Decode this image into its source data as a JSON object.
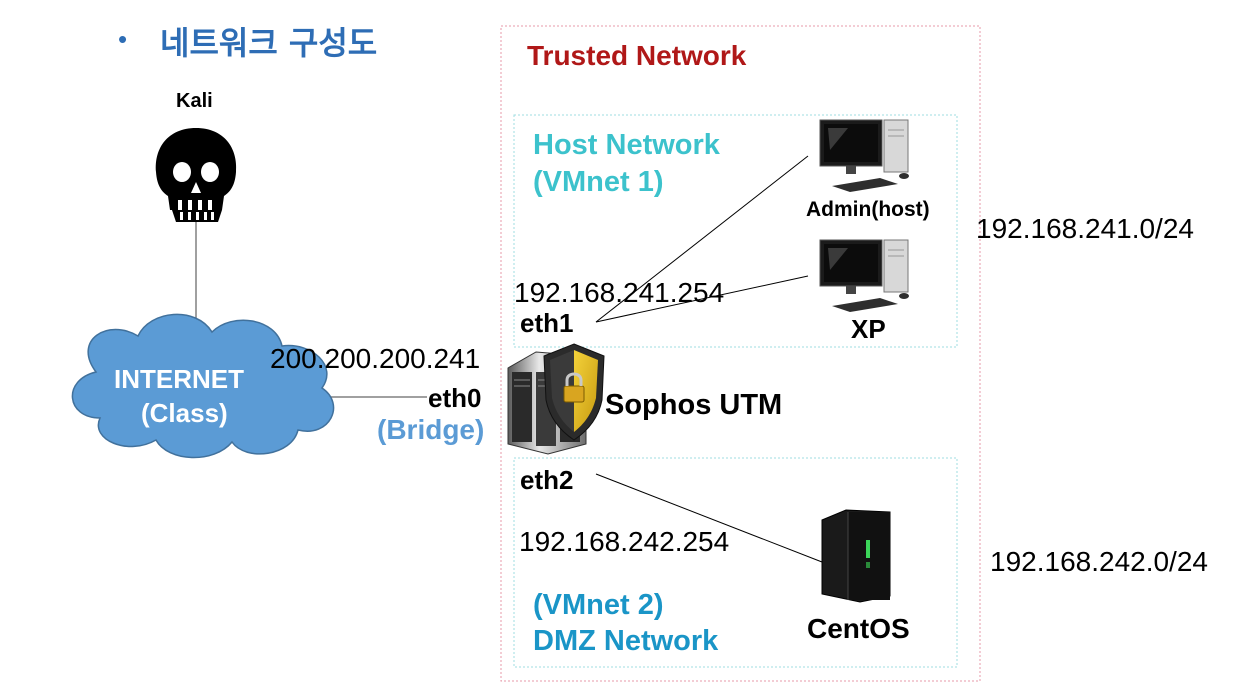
{
  "title": {
    "bullet": "•",
    "text": "네트워크 구성도"
  },
  "kali": {
    "label": "Kali"
  },
  "internet": {
    "line1": "INTERNET",
    "line2": "(Class)"
  },
  "trusted": {
    "label": "Trusted Network"
  },
  "host_network": {
    "line1": "Host Network",
    "line2": "(VMnet 1)"
  },
  "dmz_network": {
    "line1": "(VMnet 2)",
    "line2": "DMZ Network"
  },
  "utm": {
    "label": "Sophos UTM",
    "eth0": {
      "ip": "200.200.200.241",
      "name": "eth0",
      "mode": "(Bridge)"
    },
    "eth1": {
      "ip": "192.168.241.254",
      "name": "eth1"
    },
    "eth2": {
      "ip": "192.168.242.254",
      "name": "eth2"
    }
  },
  "hosts": {
    "admin": "Admin(host)",
    "xp": "XP",
    "centos": "CentOS"
  },
  "subnets": {
    "host": "192.168.241.0/24",
    "dmz": "192.168.242.0/24"
  },
  "colors": {
    "title": "#2e6db5",
    "trusted": "#b01818",
    "host_network": "#3cc2cc",
    "dmz_network": "#1a95c7",
    "bridge": "#5b9bd5",
    "cloud": "#5b9bd5"
  }
}
